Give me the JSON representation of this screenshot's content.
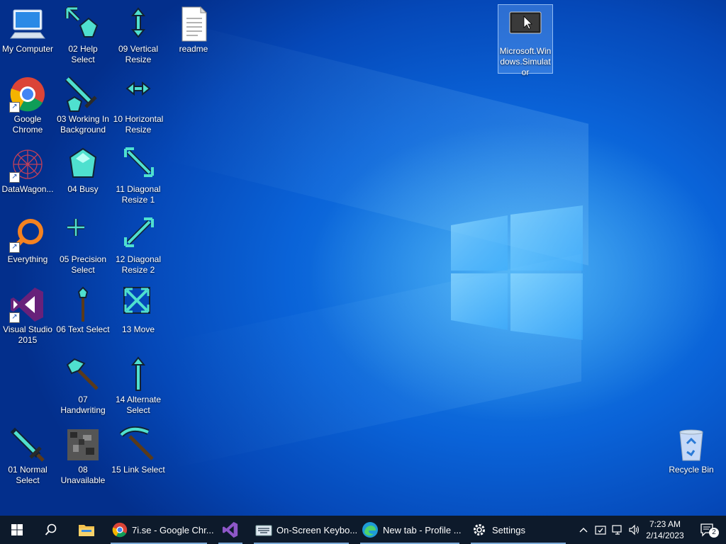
{
  "desktop": {
    "icons": [
      {
        "label": "My Computer"
      },
      {
        "label": "Google Chrome"
      },
      {
        "label": "DataWagon..."
      },
      {
        "label": "Everything"
      },
      {
        "label": "Visual Studio 2015"
      },
      {
        "label": "01 Normal Select"
      },
      {
        "label": "02 Help Select"
      },
      {
        "label": "03 Working In Background"
      },
      {
        "label": "04 Busy"
      },
      {
        "label": "05 Precision Select"
      },
      {
        "label": "06 Text Select"
      },
      {
        "label": "07 Handwriting"
      },
      {
        "label": "08 Unavailable"
      },
      {
        "label": "09 Vertical Resize"
      },
      {
        "label": "10 Horizontal Resize"
      },
      {
        "label": "11 Diagonal Resize 1"
      },
      {
        "label": "12 Diagonal Resize 2"
      },
      {
        "label": "13 Move"
      },
      {
        "label": "14 Alternate Select"
      },
      {
        "label": "15 Link Select"
      },
      {
        "label": "readme"
      },
      {
        "label": "Microsoft.Windows.Simulator"
      },
      {
        "label": "Recycle Bin"
      }
    ]
  },
  "taskbar": {
    "items": [
      {
        "label": "7i.se - Google Chr..."
      },
      {
        "label": "On-Screen Keybo..."
      },
      {
        "label": "New tab - Profile ..."
      },
      {
        "label": "Settings"
      }
    ],
    "clock": {
      "time": "7:23 AM",
      "date": "2/14/2023"
    },
    "notifications": "2"
  },
  "colors": {
    "taskbar": "#0d1a2b",
    "diamond": "#4fe0cf",
    "selection": "#78b4ff"
  }
}
